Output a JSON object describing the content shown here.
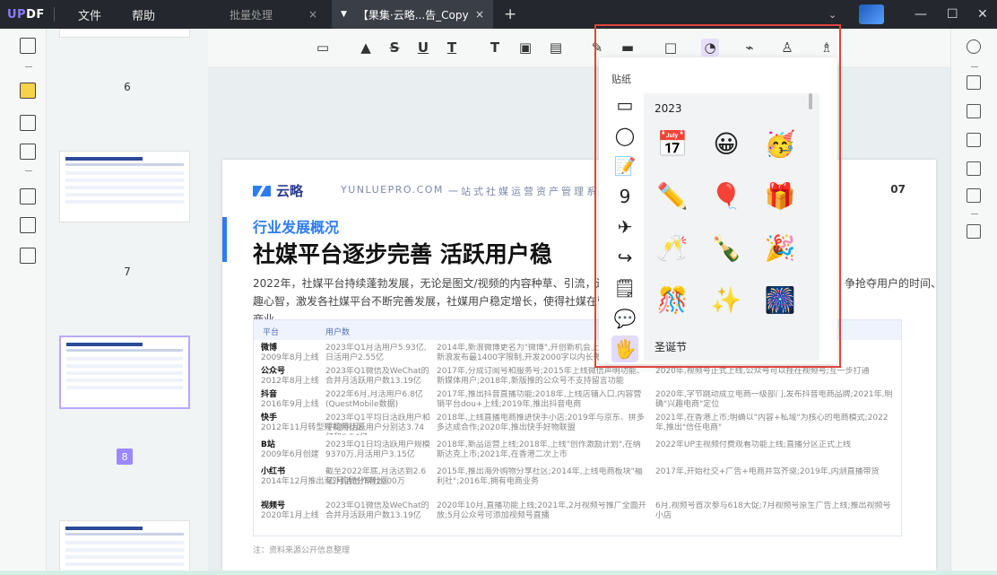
{
  "app": {
    "logo_u": "UP",
    "logo_rest": "DF"
  },
  "menu": [
    {
      "label": "文件"
    },
    {
      "label": "帮助"
    }
  ],
  "tabs": [
    {
      "label": "批量处理",
      "close": "×"
    },
    {
      "label": "【果集·云略...告_Copy",
      "close": "×",
      "caret": "▼"
    }
  ],
  "new_tab": "+",
  "window": {
    "chevron": "⌄",
    "minimize": "—",
    "maximize": "☐",
    "close": "✕"
  },
  "thumbs": {
    "pages": [
      "6",
      "7",
      "8"
    ]
  },
  "sticker_panel": {
    "title": "贴纸",
    "section_2023": "2023",
    "section_xmas": "圣诞节",
    "stickers_2023": [
      [
        "📅",
        "😀",
        "🥳"
      ],
      [
        "✏️",
        "🎈",
        "🎁"
      ],
      [
        "🥂",
        "🍾",
        "🎉"
      ],
      [
        "🎊",
        "✨",
        "🎆"
      ]
    ],
    "categories": [
      "▭",
      "◯",
      "📝",
      "9",
      "✈",
      "↪",
      "🗒",
      "💬",
      "🖐"
    ]
  },
  "document": {
    "logo": "云略",
    "domain": "YUNLUEPRO.COM",
    "slogan": "一站式社媒运营资产管理系",
    "page_number": "07",
    "subtitle": "行业发展概况",
    "heading": "社媒平台逐步完善  活跃用户稳",
    "paragraph": "2022年，社媒平台持续蓬勃发展，无论是图文/视频的内容种草、引流，还是兴趣心智，激发各社媒平台不断完善发展，社媒用户稳定增长，使得社媒在营销和商业",
    "paragraph_right": "争抢夺用户的时间、",
    "table": {
      "headers": [
        "平台",
        "用户数"
      ],
      "rows": [
        {
          "name": "微博",
          "date": "2009年8月上线",
          "users": "2023年Q1月活用户5.93亿,日活用户2.55亿",
          "t1": "2014年,新浪微博更名为\"微博\",开创新机会上市;2016年,新浪发布最1400字限制,开发2000字以内长微博",
          "t2": "...改版计划"
        },
        {
          "name": "公众号",
          "date": "2012年8月上线",
          "users": "2023年Q1微信及WeChat的合并月活跃用户数13.19亿",
          "t1": "2017年,分成订阅号和服务号;2015年上线微信声明功能、新媒体用户;2018年,新版推的公众号不支持留言功能",
          "t2": "2020年,视频号正式上线,公众号可以挂在视频号;互一步打通"
        },
        {
          "name": "抖音",
          "date": "2016年9月上线",
          "users": "2022年6月,月活用户6.8亿(QuestMobile数据)",
          "t1": "2017年,推出抖音直播功能;2018年,上线店铺入口,内容营销平台dou+上线;2019年,推出抖音电商",
          "t2": "2020年,字节跳动成立电商一级部门,发布抖音电商品牌;2021年,明确\"兴趣电商\"定位"
        },
        {
          "name": "快手",
          "date": "2012年11月转型短视频社区",
          "users": "2023年Q1平均日活跃用户和平均月活跃用户分别达3.74亿和6.54亿",
          "t1": "2018年,上线直播电商推进快手小店;2019年与京东、拼多多达成合作;2020年,推出快手好物联盟",
          "t2": "2021年,在香港上市;明确以\"内容+私域\"为核心的电商模式;2022年,推出\"信任电商\""
        },
        {
          "name": "B站",
          "date": "2009年6月创建",
          "users": "2023年Q1日均活跃用户规模9370万,月活用户3.15亿",
          "t1": "2018年,新品运营上线;2018年,上线\"创作激励计划\",在纳斯达克上市;2021年,在香港二次上市",
          "t2": "2022年UP主视频付费观看功能上线;直播分区正式上线"
        },
        {
          "name": "小红书",
          "date": "2014年12月推出海外购物分享社区",
          "users": "截至2022年底,月活达到2.6亿,月活创作者2000万",
          "t1": "2015年,推出海外购物分享社区;2014年,上线电商板块\"福利社\";2016年,拥有电商业务",
          "t2": "2017年,开始社交+广告+电商并驾齐驱;2019年,内测直播带货"
        },
        {
          "name": "视频号",
          "date": "2020年1月上线",
          "users": "2023年Q1微信及WeChat的合并月活跃用户数13.19亿",
          "t1": "2020年10月,直播功能上线;2021年,2月视频号推广全面开放;5月公众号可添加视频号直播",
          "t2": "6月,视频号首次参与618大促;7月视频号原生广告上线;推出视频号小店"
        }
      ]
    },
    "note": "注：资料来源公开信息整理"
  }
}
